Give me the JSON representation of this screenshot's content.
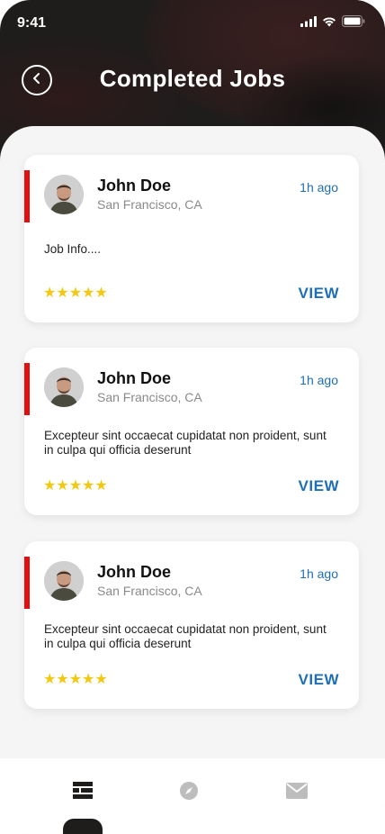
{
  "status_bar": {
    "time": "9:41"
  },
  "header": {
    "title": "Completed Jobs"
  },
  "jobs": [
    {
      "name": "John Doe",
      "location": "San Francisco, CA",
      "time": "1h ago",
      "description": "Job Info....",
      "rating": 5,
      "stars": "★★★★★",
      "action_label": "VIEW"
    },
    {
      "name": "John Doe",
      "location": "San Francisco, CA",
      "time": "1h ago",
      "description": "Excepteur sint occaecat cupidatat non proident, sunt in culpa qui officia deserunt",
      "rating": 5,
      "stars": "★★★★★",
      "action_label": "VIEW"
    },
    {
      "name": "John Doe",
      "location": "San Francisco, CA",
      "time": "1h ago",
      "description": "Excepteur sint occaecat cupidatat non proident, sunt in culpa qui officia deserunt",
      "rating": 5,
      "stars": "★★★★★",
      "action_label": "VIEW"
    }
  ],
  "bottom_nav": {
    "items": [
      {
        "icon": "list-icon",
        "active": true
      },
      {
        "icon": "compass-icon",
        "active": false
      },
      {
        "icon": "mail-icon",
        "active": false
      }
    ]
  },
  "colors": {
    "accent_red": "#e10f0f",
    "link_blue": "#1f6fb5",
    "star_yellow": "#f2c811",
    "header_dark": "#1f1c1c"
  }
}
